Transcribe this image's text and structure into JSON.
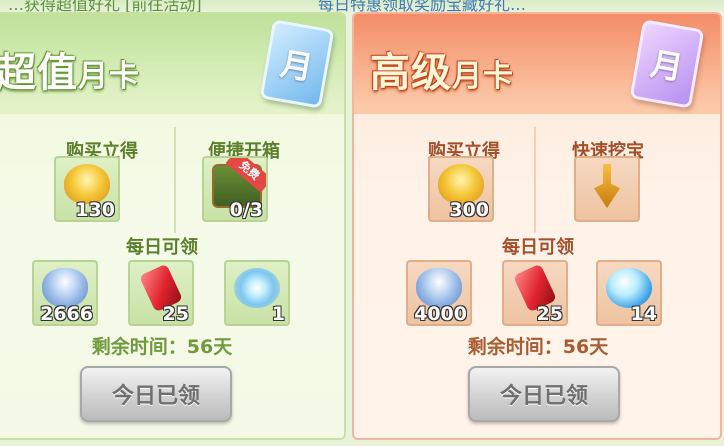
{
  "top_strip": {
    "left_text": "…获得超值好礼 [前往活动]",
    "right_text": "每日特惠领取奖励宝藏好礼…"
  },
  "card_basic": {
    "title": "超值",
    "title_sub": "月卡",
    "card_glyph": "月",
    "col1_header": "购买立得",
    "col2_header": "便捷开箱",
    "buy_item": {
      "icon": "gold-ingot-icon",
      "qty": "130"
    },
    "quick_item": {
      "icon": "treasure-chest-icon",
      "qty": "0/3",
      "badge": "免费"
    },
    "daily_header": "每日可领",
    "daily_items": [
      {
        "icon": "silver-ingot-icon",
        "qty": "2666"
      },
      {
        "icon": "red-gem-icon",
        "qty": "25"
      },
      {
        "icon": "crystal-orb-icon",
        "qty": "1"
      }
    ],
    "remaining": "剩余时间：56天",
    "button": "今日已领"
  },
  "card_premium": {
    "title": "高级",
    "title_sub": "月卡",
    "card_glyph": "月",
    "col1_header": "购买立得",
    "col2_header": "快速挖宝",
    "buy_item": {
      "icon": "gold-ingot-icon",
      "qty": "300"
    },
    "quick_item": {
      "icon": "shovel-icon",
      "qty": ""
    },
    "daily_header": "每日可领",
    "daily_items": [
      {
        "icon": "silver-ingot-icon",
        "qty": "4000"
      },
      {
        "icon": "red-gem-icon",
        "qty": "25"
      },
      {
        "icon": "blue-orb-icon",
        "qty": "14"
      }
    ],
    "remaining": "剩余时间：56天",
    "button": "今日已领"
  }
}
